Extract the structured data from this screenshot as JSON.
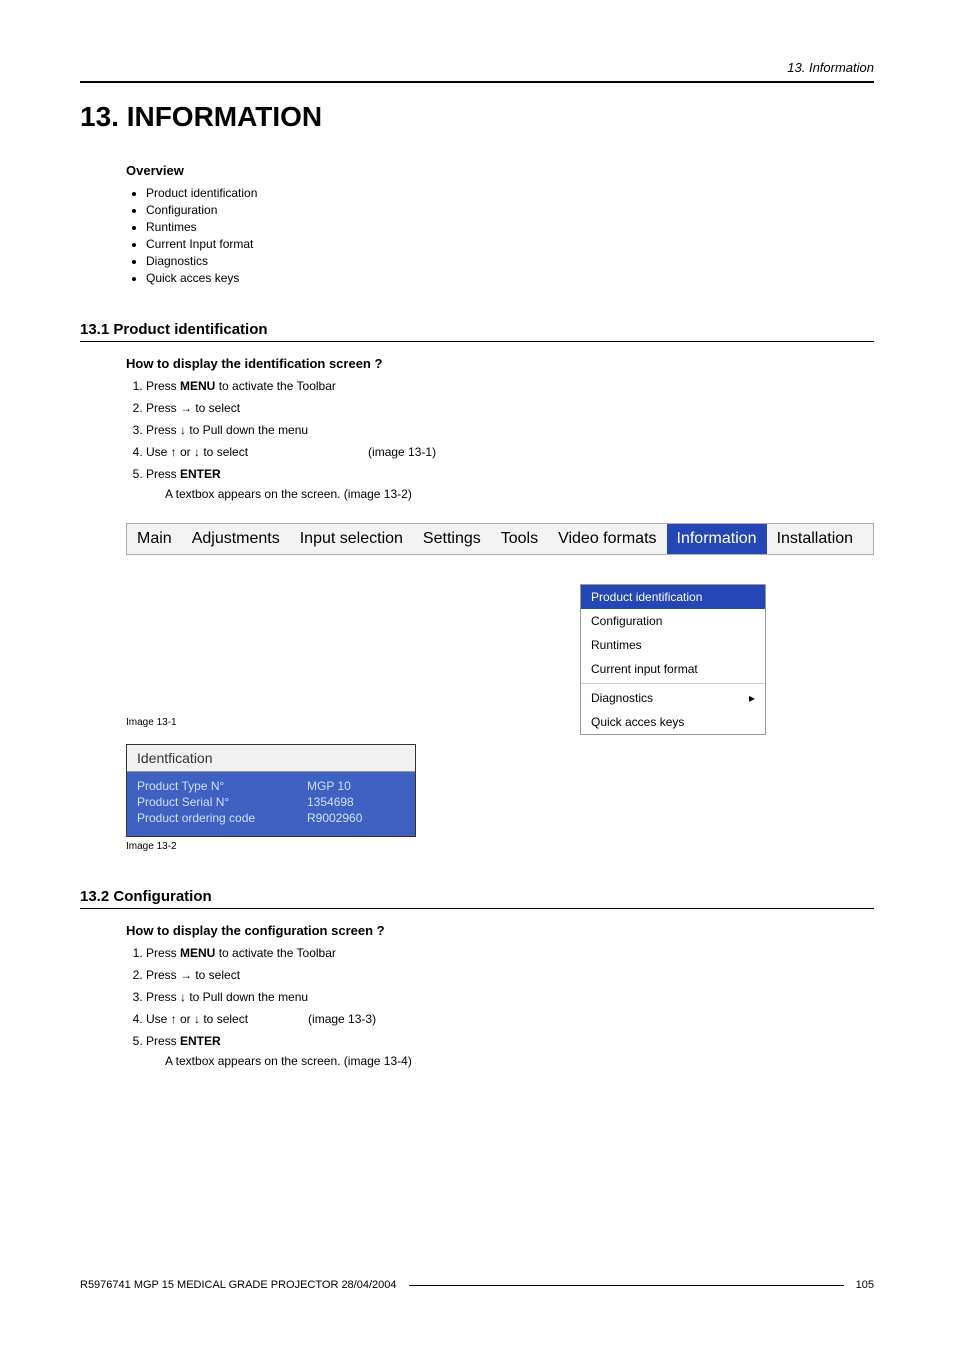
{
  "header": {
    "section_ref": "13. Information"
  },
  "chapter_title": "13. INFORMATION",
  "overview": {
    "heading": "Overview",
    "items": [
      "Product identification",
      "Configuration",
      "Runtimes",
      "Current Input format",
      "Diagnostics",
      "Quick acces keys"
    ]
  },
  "section_1": {
    "heading": "13.1 Product identification",
    "howto_heading": "How to display the identification screen ?",
    "steps": {
      "s1a": "Press ",
      "s1b": "MENU",
      "s1c": " to activate the Toolbar",
      "s2": "Press → to select",
      "s3": "Press ↓ to Pull down the menu",
      "s4": "Use ↑ or ↓ to select",
      "s4_ref": "(image 13-1)",
      "s5a": "Press ",
      "s5b": "ENTER",
      "note": "A textbox appears on the screen. (image 13-2)"
    },
    "image1_caption": "Image 13-1",
    "image2_caption": "Image 13-2"
  },
  "menu": {
    "items": [
      "Main",
      "Adjustments",
      "Input selection",
      "Settings",
      "Tools",
      "Video formats",
      "Information",
      "Installation"
    ],
    "active_index": 6,
    "dropdown": [
      {
        "label": "Product identification",
        "selected": true
      },
      {
        "label": "Configuration"
      },
      {
        "label": "Runtimes"
      },
      {
        "label": "Current input format"
      },
      {
        "label": "Diagnostics",
        "submenu": true,
        "separator_before": true
      },
      {
        "label": "Quick acces keys"
      }
    ]
  },
  "idbox": {
    "title": "Identfication",
    "rows": [
      {
        "label": "Product Type N°",
        "value": "MGP 10"
      },
      {
        "label": "Product Serial N°",
        "value": "1354698"
      },
      {
        "label": "Product ordering code",
        "value": "R9002960"
      }
    ]
  },
  "section_2": {
    "heading": "13.2 Configuration",
    "howto_heading": "How to display the configuration screen ?",
    "steps": {
      "s1a": "Press ",
      "s1b": "MENU",
      "s1c": " to activate the Toolbar",
      "s2": "Press → to select",
      "s3": "Press ↓ to Pull down the menu",
      "s4": "Use ↑ or ↓ to select",
      "s4_ref": "(image 13-3)",
      "s5a": "Press ",
      "s5b": "ENTER",
      "note": "A textbox appears on the screen. (image 13-4)"
    }
  },
  "footer": {
    "left": "R5976741  MGP 15 MEDICAL GRADE PROJECTOR  28/04/2004",
    "page": "105"
  }
}
